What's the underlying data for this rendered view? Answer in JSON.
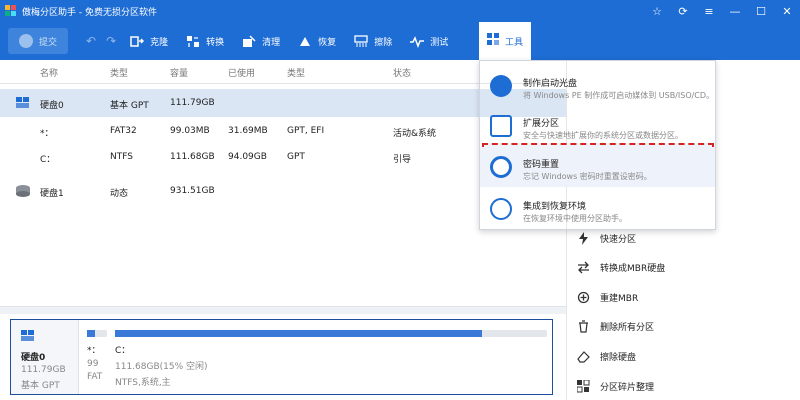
{
  "window": {
    "title": "傲梅分区助手 - 免费无损分区软件"
  },
  "toolbar": {
    "submit_label": "提交",
    "buttons": [
      {
        "label": "克隆",
        "icon": "clone-icon"
      },
      {
        "label": "转换",
        "icon": "convert-icon"
      },
      {
        "label": "清理",
        "icon": "cleanup-icon"
      },
      {
        "label": "恢复",
        "icon": "recover-icon"
      },
      {
        "label": "擦除",
        "icon": "wipe-icon"
      },
      {
        "label": "测试",
        "icon": "test-icon"
      }
    ],
    "tools_label": "工具"
  },
  "table": {
    "headers": [
      "名称",
      "类型",
      "容量",
      "已使用",
      "类型",
      "状态"
    ],
    "rows": [
      {
        "name": "硬盘0",
        "type": "基本 GPT",
        "capacity": "111.79GB",
        "used": "",
        "fs": "",
        "status": ""
      },
      {
        "name": "*：",
        "type": "FAT32",
        "capacity": "99.03MB",
        "used": "31.69MB",
        "fs": "GPT, EFI",
        "status": "活动&系统"
      },
      {
        "name": "C：",
        "type": "NTFS",
        "capacity": "111.68GB",
        "used": "94.09GB",
        "fs": "GPT",
        "status": "引导"
      },
      {
        "name": "硬盘1",
        "type": "动态",
        "capacity": "931.51GB",
        "used": "",
        "fs": "",
        "status": ""
      }
    ]
  },
  "diskmap": {
    "disk_name": "硬盘0",
    "disk_size": "111.79GB",
    "disk_type": "基本 GPT",
    "part1_name": "*：",
    "part1_size": "99",
    "part1_fs": "FAT",
    "part2_name": "C：",
    "part2_size": "111.68GB(15% 空闲)",
    "part2_fs": "NTFS,系统,主",
    "part2_used_fraction": 0.85
  },
  "dropdown": {
    "items": [
      {
        "title": "制作启动光盘",
        "desc": "将 Windows PE 制作成可启动媒体到 USB/ISO/CD。"
      },
      {
        "title": "扩展分区",
        "desc": "安全与快速地扩展你的系统分区或数据分区。"
      },
      {
        "title": "密码重置",
        "desc": "忘记 Windows 密码时重置设密码。"
      },
      {
        "title": "集成到恢复环境",
        "desc": "在恢复环境中使用分区助手。"
      }
    ]
  },
  "sidepanel": {
    "items": [
      {
        "label": "快速分区",
        "icon": "lightning-icon"
      },
      {
        "label": "转换成MBR硬盘",
        "icon": "convert-mbr-icon"
      },
      {
        "label": "重建MBR",
        "icon": "rebuild-mbr-icon"
      },
      {
        "label": "删除所有分区",
        "icon": "trash-icon"
      },
      {
        "label": "擦除硬盘",
        "icon": "eraser-icon"
      },
      {
        "label": "分区碎片整理",
        "icon": "defrag-icon"
      }
    ]
  },
  "colors": {
    "brand": "#1e6dd4",
    "highlight": "#d5241f"
  }
}
